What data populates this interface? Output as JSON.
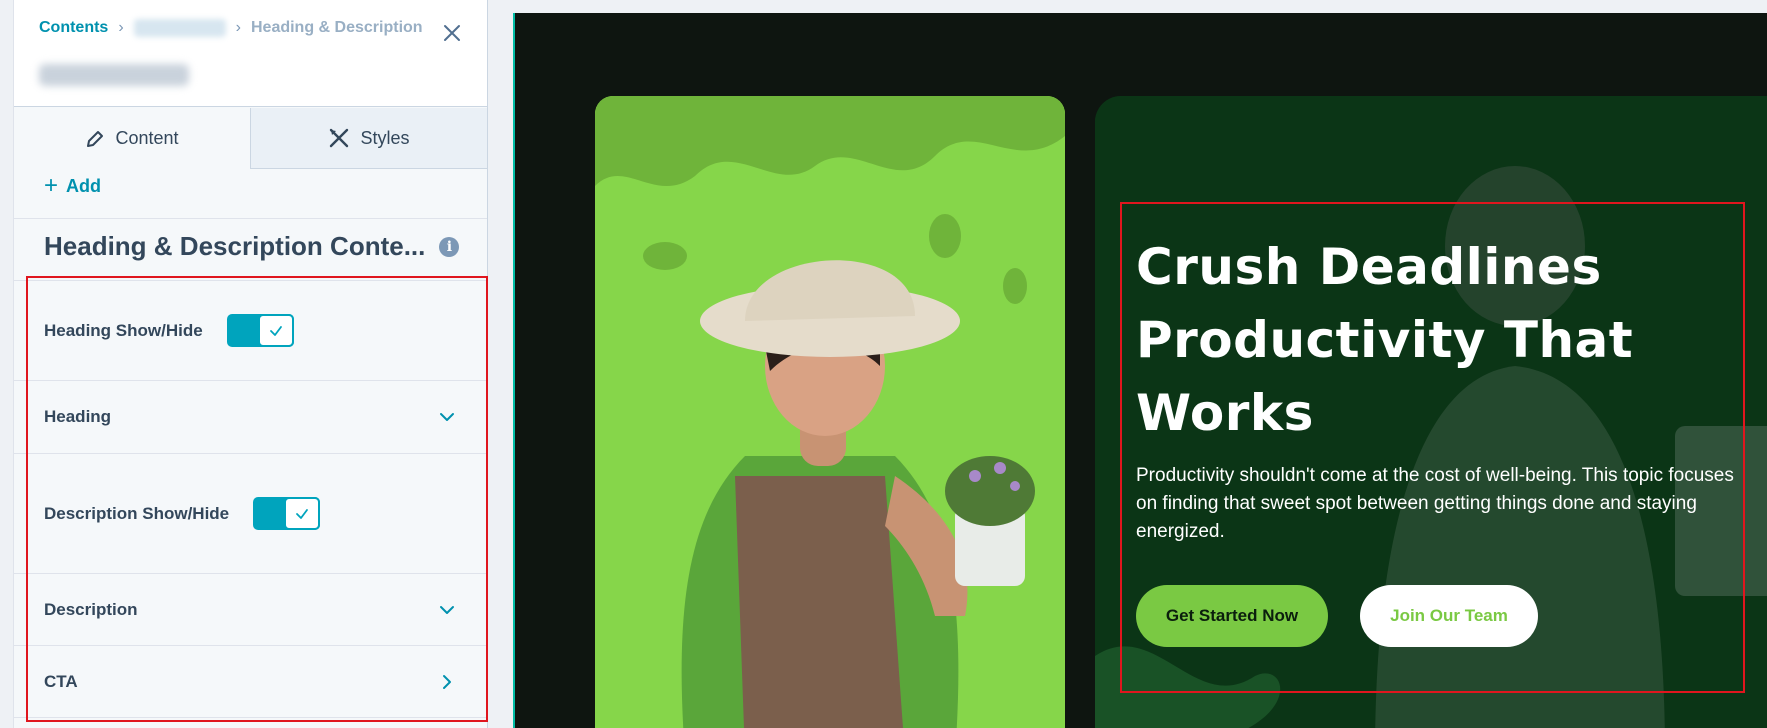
{
  "breadcrumb": {
    "root": "Contents",
    "separator": "›",
    "current": "Heading & Description"
  },
  "tabs": {
    "content": "Content",
    "styles": "Styles"
  },
  "add_label": "Add",
  "section": {
    "title": "Heading & Description Conte...",
    "info_glyph": "i"
  },
  "fields": {
    "heading_toggle": "Heading Show/Hide",
    "heading": "Heading",
    "description_toggle": "Description Show/Hide",
    "description": "Description",
    "cta": "CTA"
  },
  "toggles": {
    "heading_visible": true,
    "description_visible": true
  },
  "preview": {
    "headline_line1": "Crush Deadlines",
    "headline_line2": "Productivity That",
    "headline_line3": "Works",
    "description": "Productivity shouldn't come at the cost of well-being. This topic focuses on finding that sweet spot between getting things done and staying energized.",
    "primary_button": "Get Started Now",
    "secondary_button": "Join Our Team"
  },
  "colors": {
    "accent": "#00a4bd",
    "link": "#0091ae",
    "highlight": "#e0161e",
    "brand_green": "#7ac943",
    "dark_green": "#0b3516"
  },
  "icons": {
    "close": "close-icon",
    "pencil": "pencil-icon",
    "styles": "brush-ruler-icon",
    "add": "plus-icon",
    "info": "info-icon",
    "check": "check-icon",
    "chevron_down": "chevron-down-icon",
    "chevron_right": "chevron-right-icon"
  }
}
